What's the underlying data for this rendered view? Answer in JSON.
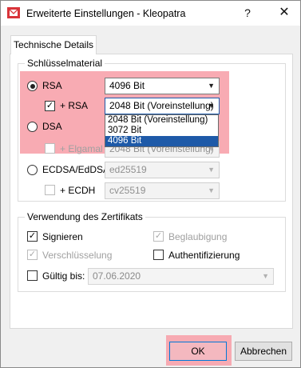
{
  "window": {
    "title": "Erweiterte Einstellungen - Kleopatra",
    "help_label": "?",
    "close_label": "✕"
  },
  "tab": {
    "label": "Technische Details"
  },
  "key_material": {
    "title": "Schlüsselmaterial",
    "rsa": {
      "label": "RSA",
      "selected": true,
      "combo_value": "4096 Bit"
    },
    "rsa_sub": {
      "label": "+ RSA",
      "checked": true,
      "combo_value": "2048 Bit (Voreinstellung)"
    },
    "dropdown_options": [
      "2048 Bit (Voreinstellung)",
      "3072 Bit",
      "4096 Bit"
    ],
    "dropdown_selected": "4096 Bit",
    "dsa": {
      "label": "DSA",
      "selected": false
    },
    "elgamal": {
      "label": "+ Elgamal",
      "checked": false,
      "combo_value": "2048 Bit (Voreinstellung)"
    },
    "ecdsa": {
      "label": "ECDSA/EdDSA",
      "selected": false,
      "combo_value": "ed25519"
    },
    "ecdh": {
      "label": "+ ECDH",
      "checked": false,
      "combo_value": "cv25519"
    }
  },
  "certificate_usage": {
    "title": "Verwendung des Zertifikats",
    "sign": {
      "label": "Signieren",
      "checked": true
    },
    "certify": {
      "label": "Beglaubigung",
      "checked": true
    },
    "encrypt": {
      "label": "Verschlüsselung",
      "checked": true
    },
    "authenticate": {
      "label": "Authentifizierung",
      "checked": false
    },
    "valid_until": {
      "label": "Gültig bis:",
      "checked": false,
      "date": "07.06.2020"
    }
  },
  "buttons": {
    "ok": "OK",
    "cancel": "Abbrechen"
  },
  "colors": {
    "highlight": "#f7a5ad",
    "selection": "#1e5aa8",
    "app_icon": "#d9343a"
  }
}
